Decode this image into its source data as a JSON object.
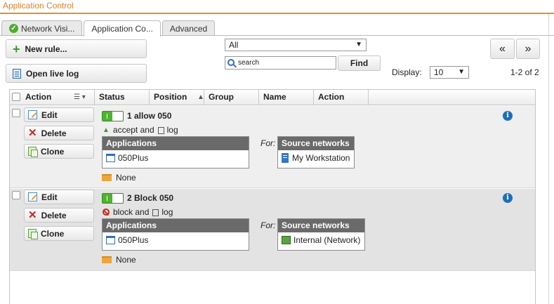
{
  "window": {
    "title": "Application Control"
  },
  "tabs": [
    {
      "label": "Network Visi...",
      "status": "ok"
    },
    {
      "label": "Application Co...",
      "active": true
    },
    {
      "label": "Advanced"
    }
  ],
  "toolbar": {
    "new_rule_label": "New rule...",
    "open_live_log_label": "Open live log",
    "filter_value": "All",
    "search_placeholder": "search",
    "find_label": "Find",
    "display_label": "Display:",
    "display_value": "10",
    "count_text": "1-2 of 2",
    "prev_label": "«",
    "next_label": "»"
  },
  "table": {
    "columns": [
      "Action",
      "Status",
      "Position",
      "Group",
      "Name",
      "Action"
    ],
    "rows": [
      {
        "edit_label": "Edit",
        "delete_label": "Delete",
        "clone_label": "Clone",
        "title": "1 allow 050",
        "action_text": "accept and",
        "log_text": "log",
        "applications_header": "Applications",
        "application": "050Plus",
        "for_label": "For:",
        "source_header": "Source networks",
        "source": "My Workstation",
        "group": "None"
      },
      {
        "edit_label": "Edit",
        "delete_label": "Delete",
        "clone_label": "Clone",
        "title": "2 Block 050",
        "action_text": "block and",
        "log_text": "log",
        "applications_header": "Applications",
        "application": "050Plus",
        "for_label": "For:",
        "source_header": "Source networks",
        "source": "Internal (Network)",
        "group": "None"
      }
    ]
  },
  "colors": {
    "accent": "#e8901c",
    "enabled": "#4fb331",
    "info": "#1d6fbd"
  }
}
